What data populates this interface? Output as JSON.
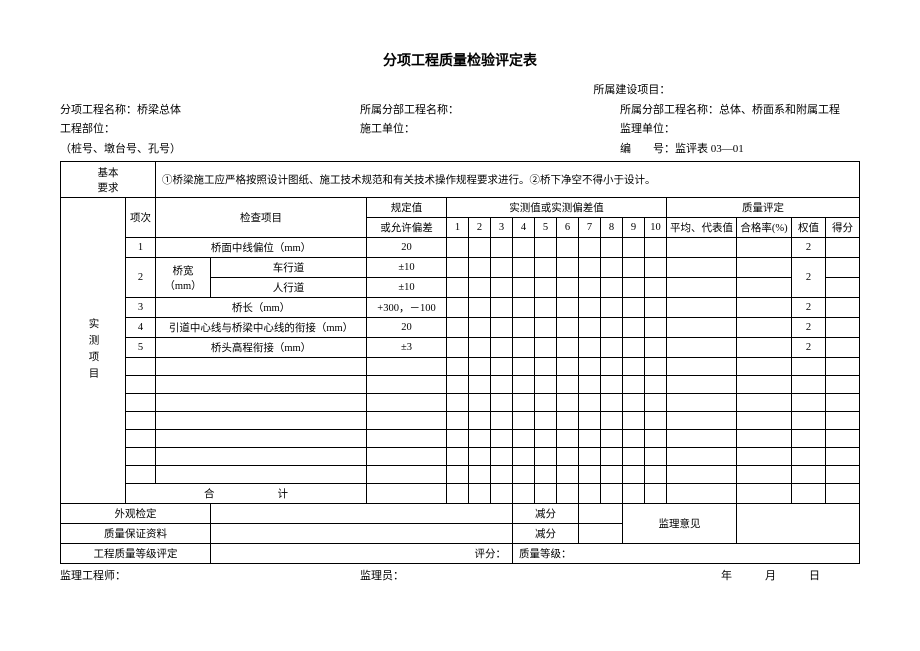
{
  "title": "分项工程质量检验评定表",
  "meta": {
    "project_owner_label": "所属建设项目：",
    "sub_item_name_label": "分项工程名称：",
    "sub_item_name_value": "桥梁总体",
    "sub_part_name_label": "所属分部工程名称：",
    "sub_part_name_value": "所属分部工程名称：总体、桥面系和附属工程",
    "position_label": "工程部位：",
    "construction_unit_label": "施工单位：",
    "supervision_unit_label": "监理单位：",
    "pile_label": "（桩号、墩台号、孔号）",
    "code_label": "编　　号：",
    "code_value": "监评表 03—01"
  },
  "basic_req": {
    "label": "基本要求",
    "text": "①桥梁施工应严格按照设计图纸、施工技术规范和有关技术操作规程要求进行。②桥下净空不得小于设计。"
  },
  "headers": {
    "seq": "项次",
    "check_item": "检查项目",
    "spec_value_l1": "规定值",
    "spec_value_l2": "或允许偏差",
    "measured_label": "实测值或实测偏差值",
    "cols": [
      "1",
      "2",
      "3",
      "4",
      "5",
      "6",
      "7",
      "8",
      "9",
      "10"
    ],
    "quality_eval": "质量评定",
    "avg_rep": "平均、代表值",
    "pass_rate": "合格率(%)",
    "weight": "权值",
    "score": "得分"
  },
  "side_label": "实测项目",
  "rows": [
    {
      "seq": "1",
      "item_a": "桥面中线偏位（mm）",
      "item_b": "",
      "spec": "20",
      "weight": "2"
    },
    {
      "seq": "2",
      "item_a": "桥宽",
      "unit": "（mm）",
      "item_b": "车行道",
      "spec": "±10",
      "weight": "2",
      "rowspan": true
    },
    {
      "seq": "",
      "item_a": "",
      "item_b": "人行道",
      "spec": "±10",
      "weight": ""
    },
    {
      "seq": "3",
      "item_a": "桥长（mm）",
      "item_b": "",
      "spec": "+300，－100",
      "weight": "2"
    },
    {
      "seq": "4",
      "item_a": "引道中心线与桥梁中心线的衔接（mm）",
      "item_b": "",
      "spec": "20",
      "weight": "2"
    },
    {
      "seq": "5",
      "item_a": "桥头高程衔接（mm）",
      "item_b": "",
      "spec": "±3",
      "weight": "2"
    }
  ],
  "total_label": "合　　　　　　计",
  "bottom": {
    "appearance": "外观检定",
    "deduct": "减分",
    "supervision_opinion": "监理意见",
    "qa_material": "质量保证资料",
    "grade_eval": "工程质量等级评定",
    "eval_score": "评分：",
    "quality_grade": "质量等级："
  },
  "footer": {
    "engineer": "监理工程师：",
    "supervisor": "监理员：",
    "date": "年　　　月　　　日"
  }
}
